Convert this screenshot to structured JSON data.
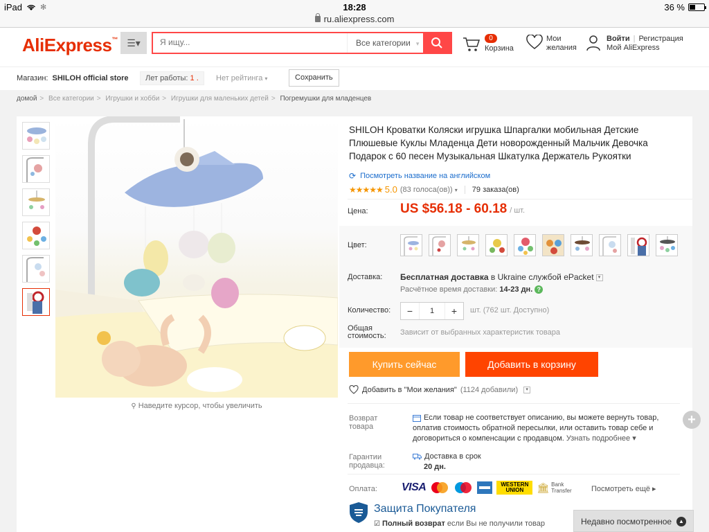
{
  "status_bar": {
    "device": "iPad",
    "time": "18:28",
    "battery": "36 %",
    "url": "ru.aliexpress.com"
  },
  "header": {
    "logo": "AliExpress",
    "search_placeholder": "Я ищу...",
    "category_select": "Все категории",
    "cart_count": "0",
    "cart_label": "Корзина",
    "wishlist_label_1": "Мои",
    "wishlist_label_2": "желания",
    "signin": "Войти",
    "register": "Регистрация",
    "my_account": "Мой AliExpress"
  },
  "store": {
    "label": "Магазин:",
    "name": "SHILOH official store",
    "years_label": "Лет работы:",
    "years_value": "1 .",
    "rating": "Нет рейтинга",
    "save_button": "Сохранить"
  },
  "breadcrumb": [
    "домой",
    "Все категории",
    "Игрушки и хобби",
    "Игрушки для маленьких детей",
    "Погремушки для младенцев"
  ],
  "product": {
    "title": "SHILOH Кроватки Коляски игрушка Шпаргалки мобильная Детские Плюшевые Куклы Младенца Дети новорожденный Мальчик Девочка Подарок с 60 песен Музыкальная Шкатулка Держатель Рукоятки",
    "translate_link": "Посмотреть название на английском",
    "stars": "★★★★★",
    "rating": "5.0",
    "votes": "(83 голоса(ов))",
    "orders": "79 заказа(ов)",
    "price_label": "Цена:",
    "price": "US $56.18 - 60.18",
    "price_unit": "/ шт.",
    "color_label": "Цвет:",
    "shipping_label": "Доставка:",
    "shipping_text_bold": "Бесплатная доставка",
    "shipping_text_in": " в ",
    "shipping_country": "Ukraine",
    "shipping_via": " службой ",
    "shipping_service": "ePacket",
    "eta_label": "Расчётное время доставки:",
    "eta_value": "14-23 дн.",
    "qty_label": "Количество:",
    "qty_value": "1",
    "qty_note": "шт. (762 шт. Доступно)",
    "total_label_1": "Общая",
    "total_label_2": "стоимость:",
    "total_value": "Зависит от выбранных характеристик товара",
    "buy_now": "Купить сейчас",
    "add_to_cart": "Добавить в корзину",
    "add_wishlist": "Добавить в \"Мои желания\"",
    "wishlist_count": "(1124 добавили)",
    "zoom_hint": "Наведите курсор, чтобы увеличить",
    "return_label_1": "Возврат",
    "return_label_2": "товара",
    "return_text": "Если товар не соответствует описанию, вы можете вернуть товар, оплатив стоимость обратной пересылки, или оставить товар себе и договориться о компенсации с продавцом.",
    "return_more": "Узнать подробнее ▾",
    "guarantee_label_1": "Гарантии",
    "guarantee_label_2": "продавца:",
    "guarantee_text": "Доставка в срок",
    "guarantee_days": "20 дн.",
    "payment_label": "Оплата:",
    "payment_more": "Посмотреть ещё ▸",
    "protection_title": "Защита Покупателя",
    "protection_line_bold": "Полный возврат",
    "protection_line_rest": " если Вы не получили товар"
  },
  "payment_methods": [
    "VISA",
    "MasterCard",
    "Maestro",
    "American Express",
    "WESTERN UNION",
    "Bank Transfer"
  ],
  "recently_viewed": "Недавно посмотренное",
  "colors": {
    "accent": "#e62e04",
    "buy": "#ff9a2b",
    "cart": "#ff4400",
    "link": "#1a6ccc",
    "star": "#f59500"
  }
}
